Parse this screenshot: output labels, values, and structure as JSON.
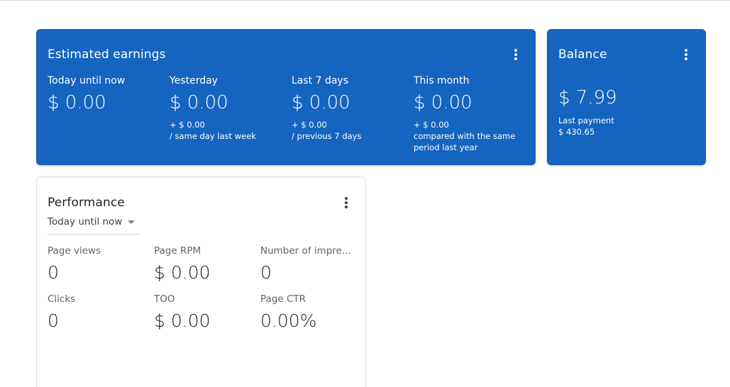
{
  "earnings": {
    "title": "Estimated earnings",
    "metrics": [
      {
        "label": "Today until now",
        "value": "$ 0.00",
        "compare": ""
      },
      {
        "label": "Yesterday",
        "value": "$ 0.00",
        "compare": "+ $ 0.00\n/ same day last week"
      },
      {
        "label": "Last 7 days",
        "value": "$ 0.00",
        "compare": "+ $ 0.00\n/ previous 7 days"
      },
      {
        "label": "This month",
        "value": "$ 0.00",
        "compare": "+ $ 0.00\ncompared with the same\nperiod last year"
      }
    ]
  },
  "balance": {
    "title": "Balance",
    "value": "$ 7.99",
    "last_payment_label": "Last payment",
    "last_payment_value": "$ 430.65"
  },
  "performance": {
    "title": "Performance",
    "range": "Today until now",
    "metrics": [
      {
        "label": "Page views",
        "value": "0"
      },
      {
        "label": "Page RPM",
        "value": "$ 0.00"
      },
      {
        "label": "Number of impressions",
        "value": "0"
      },
      {
        "label": "Clicks",
        "value": "0"
      },
      {
        "label": "TOO",
        "value": "$ 0.00"
      },
      {
        "label": "Page CTR",
        "value": "0.00%"
      }
    ]
  },
  "icons": {
    "menu": "more-vert-icon",
    "dropdown": "arrow-drop-down-icon"
  },
  "colors": {
    "card_blue": "#1565c0",
    "text_dark": "#202124",
    "text_muted": "#5f6368"
  }
}
